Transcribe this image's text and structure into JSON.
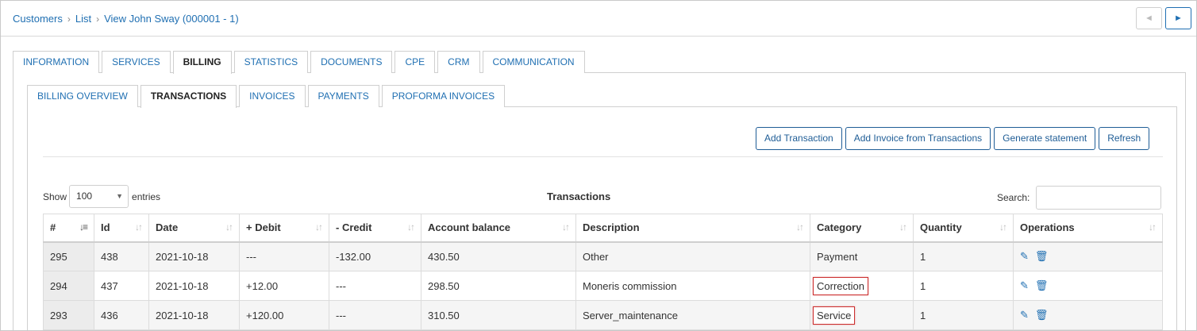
{
  "breadcrumb": [
    "Customers",
    "List",
    "View John Sway (000001 - 1)"
  ],
  "nav": {
    "prev": "◄",
    "next": "►"
  },
  "main_tabs": [
    "INFORMATION",
    "SERVICES",
    "BILLING",
    "STATISTICS",
    "DOCUMENTS",
    "CPE",
    "CRM",
    "COMMUNICATION"
  ],
  "main_active": "BILLING",
  "billing_tabs": [
    "BILLING OVERVIEW",
    "TRANSACTIONS",
    "INVOICES",
    "PAYMENTS",
    "PROFORMA INVOICES"
  ],
  "billing_active": "TRANSACTIONS",
  "toolbar": {
    "add_transaction": "Add Transaction",
    "add_invoice": "Add Invoice from Transactions",
    "generate_statement": "Generate statement",
    "refresh": "Refresh"
  },
  "table_controls": {
    "show_label": "Show",
    "entries_value": "100",
    "entries_label": "entries",
    "title": "Transactions",
    "search_label": "Search:"
  },
  "table": {
    "headers": [
      "#",
      "Id",
      "Date",
      "+ Debit",
      "- Credit",
      "Account balance",
      "Description",
      "Category",
      "Quantity",
      "Operations"
    ],
    "rows": [
      {
        "num": "295",
        "id": "438",
        "date": "2021-10-18",
        "debit": "---",
        "credit": "-132.00",
        "balance": "430.50",
        "description": "Other",
        "category": "Payment",
        "quantity": "1",
        "highlighted": false
      },
      {
        "num": "294",
        "id": "437",
        "date": "2021-10-18",
        "debit": "+12.00",
        "credit": "---",
        "balance": "298.50",
        "description": "Moneris commission",
        "category": "Correction",
        "quantity": "1",
        "highlighted": true
      },
      {
        "num": "293",
        "id": "436",
        "date": "2021-10-18",
        "debit": "+120.00",
        "credit": "---",
        "balance": "310.50",
        "description": "Server_maintenance",
        "category": "Service",
        "quantity": "1",
        "highlighted": true
      }
    ]
  },
  "icons": {
    "edit": "edit-icon",
    "delete": "trash-icon"
  },
  "colors": {
    "link": "#1f6fb2",
    "button_border": "#1f5d96",
    "highlight": "#cc2e2e"
  }
}
